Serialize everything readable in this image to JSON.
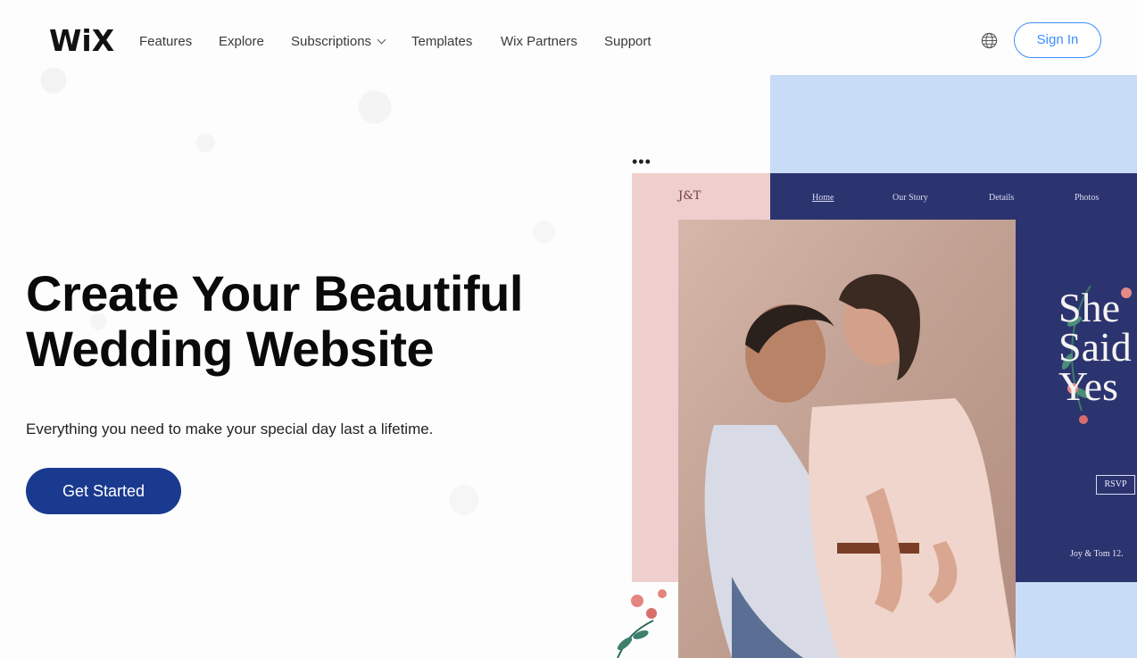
{
  "nav": {
    "logo": "WiX",
    "links": [
      "Features",
      "Explore",
      "Subscriptions",
      "Templates",
      "Wix Partners",
      "Support"
    ],
    "globe_icon": "globe-icon",
    "signin_label": "Sign In"
  },
  "hero": {
    "title_line1": "Create Your Beautiful",
    "title_line2": "Wedding Website",
    "subtitle": "Everything you need to make your special day last a lifetime.",
    "cta_label": "Get Started"
  },
  "mockup": {
    "monogram": "J&T",
    "nav_items": [
      "Home",
      "Our Story",
      "Details",
      "Photos"
    ],
    "headline": [
      "She",
      "Said",
      "Yes"
    ],
    "rsvp_label": "RSVP",
    "names_date": "Joy & Tom   12."
  },
  "colors": {
    "accent_blue": "#3d8dff",
    "cta_navy": "#1a3a8f",
    "mock_navy": "#2c3470",
    "mock_pink": "#efcfcd",
    "mock_sky": "#c9dcf7"
  }
}
